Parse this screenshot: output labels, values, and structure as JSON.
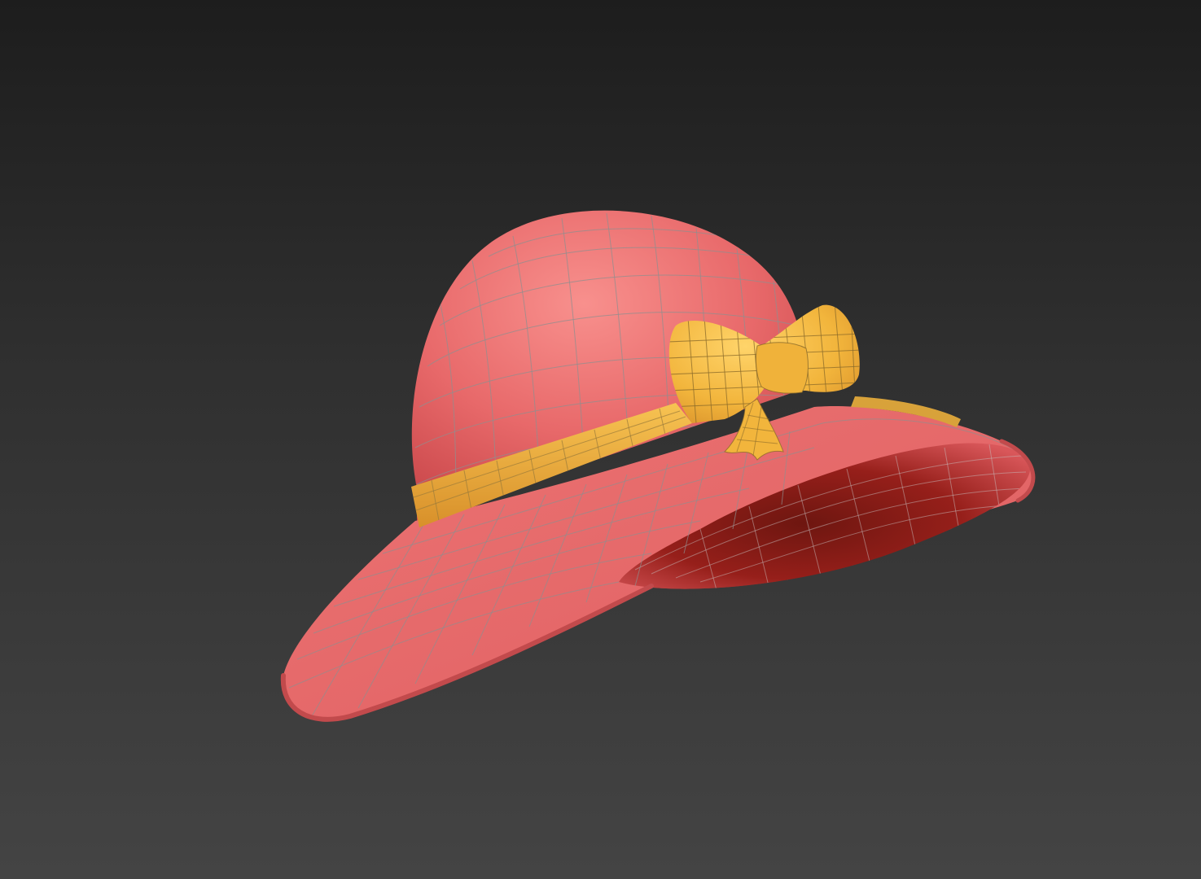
{
  "viewport": {
    "background_top": "#1d1d1d",
    "background_bottom": "#444444"
  },
  "model": {
    "subject": "hat",
    "parts": [
      "crown",
      "brim",
      "band",
      "bow"
    ],
    "colors": {
      "felt": "#e8696a",
      "felt_shadow": "#c9474a",
      "felt_highlight": "#f58a88",
      "inner_dark": "#6e1610",
      "inner_mid": "#a92a24",
      "ribbon": "#f2b53c",
      "ribbon_shadow": "#d8902a",
      "wire": "#8f8f8f"
    }
  }
}
